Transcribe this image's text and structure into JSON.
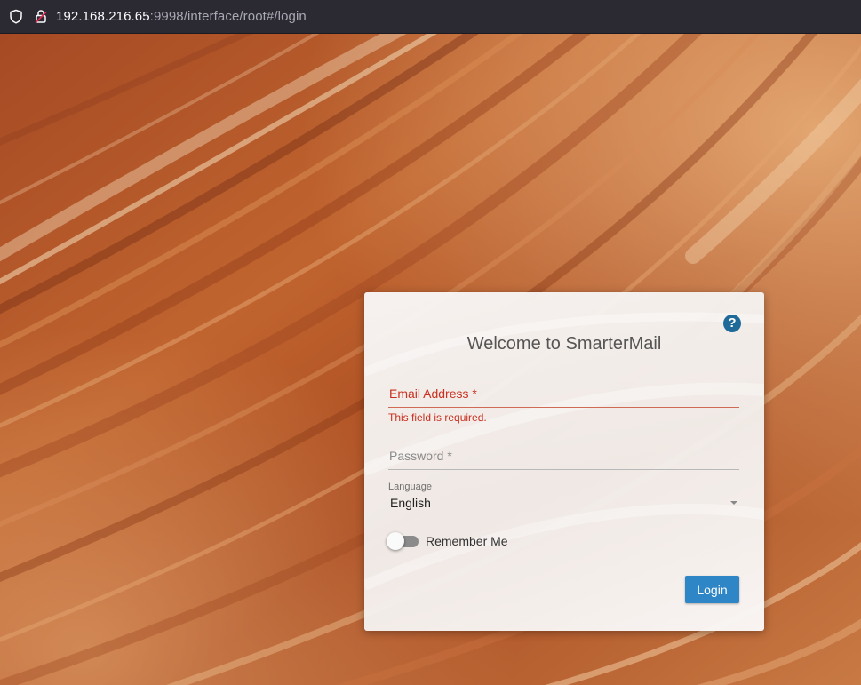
{
  "browser": {
    "url_host": "192.168.216.65",
    "url_rest": ":9998/interface/root#/login",
    "icons": [
      "shield-icon",
      "lock-slash-icon"
    ]
  },
  "login": {
    "title": "Welcome to SmarterMail",
    "help_icon": "?",
    "email_label": "Email Address",
    "required_marker": "*",
    "email_error": "This field is required.",
    "password_label": "Password",
    "language_label": "Language",
    "language_value": "English",
    "remember_me_label": "Remember Me",
    "remember_me_on": false,
    "login_button": "Login"
  },
  "colors": {
    "accent": "#2f86c6",
    "error": "#c9301f",
    "help": "#1f6a99",
    "browser_bar": "#2b2a33",
    "background_rock": "#b4582a"
  }
}
